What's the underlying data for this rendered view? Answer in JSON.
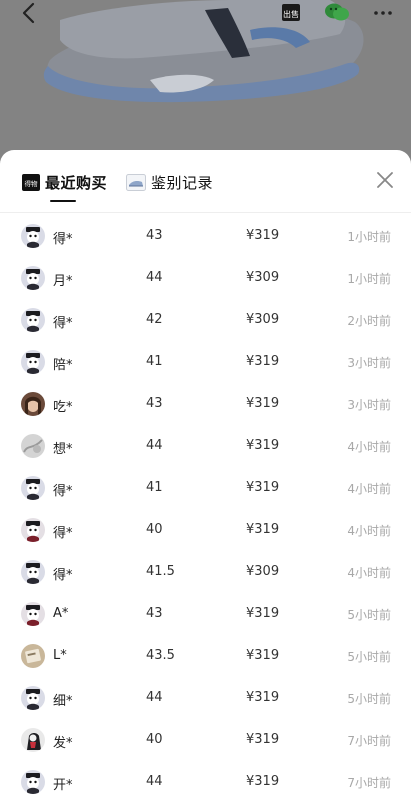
{
  "header": {
    "back_icon": "chevron-left-icon",
    "sell_label": "出售",
    "share_icon": "wechat-icon",
    "more_icon": "more-dots-icon"
  },
  "sheet": {
    "tabs": [
      {
        "label": "最近购买",
        "icon": "dewu-logo-icon",
        "active": true
      },
      {
        "label": "鉴别记录",
        "icon": "sneaker-thumb-icon",
        "active": false
      }
    ],
    "close_icon": "close-icon",
    "logo_text": "得物"
  },
  "purchases": [
    {
      "user": "得*",
      "size": "43",
      "price": "¥319",
      "time": "1小时前",
      "avatar": "mascot"
    },
    {
      "user": "月*",
      "size": "44",
      "price": "¥309",
      "time": "1小时前",
      "avatar": "mascot"
    },
    {
      "user": "得*",
      "size": "42",
      "price": "¥309",
      "time": "2小时前",
      "avatar": "mascot"
    },
    {
      "user": "陪*",
      "size": "41",
      "price": "¥319",
      "time": "3小时前",
      "avatar": "mascot"
    },
    {
      "user": "吃*",
      "size": "43",
      "price": "¥319",
      "time": "3小时前",
      "avatar": "photo-face"
    },
    {
      "user": "想*",
      "size": "44",
      "price": "¥319",
      "time": "4小时前",
      "avatar": "photo-gray"
    },
    {
      "user": "得*",
      "size": "41",
      "price": "¥319",
      "time": "4小时前",
      "avatar": "mascot"
    },
    {
      "user": "得*",
      "size": "40",
      "price": "¥319",
      "time": "4小时前",
      "avatar": "mascot-red"
    },
    {
      "user": "得*",
      "size": "41.5",
      "price": "¥309",
      "time": "4小时前",
      "avatar": "mascot"
    },
    {
      "user": "A*",
      "size": "43",
      "price": "¥319",
      "time": "5小时前",
      "avatar": "mascot-red"
    },
    {
      "user": "L*",
      "size": "43.5",
      "price": "¥319",
      "time": "5小时前",
      "avatar": "photo-card"
    },
    {
      "user": "细*",
      "size": "44",
      "price": "¥319",
      "time": "5小时前",
      "avatar": "mascot"
    },
    {
      "user": "发*",
      "size": "40",
      "price": "¥319",
      "time": "7小时前",
      "avatar": "photo-dark"
    },
    {
      "user": "开*",
      "size": "44",
      "price": "¥319",
      "time": "7小时前",
      "avatar": "mascot"
    }
  ],
  "colors": {
    "overlay": "#838383",
    "sheet_bg": "#ffffff",
    "time_text": "#a8a8a8",
    "shoe_accent": "#7c96bf"
  }
}
